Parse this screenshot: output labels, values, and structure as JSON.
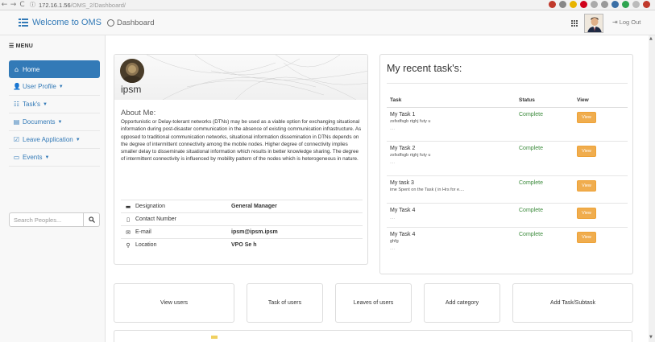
{
  "browser": {
    "back": "←",
    "forward": "→",
    "reload": "C",
    "host": "172.16.1.56",
    "path": "/OMS_2/Dashboard/"
  },
  "navbar": {
    "brand": "Welcome to OMS",
    "dashboard": "Dashboard",
    "logout": "Log Out"
  },
  "sidebar": {
    "menu_title": "MENU",
    "items": [
      {
        "label": "Home",
        "icon": "home-icon",
        "glyph": "⌂",
        "dropdown": false
      },
      {
        "label": "User Profile",
        "icon": "user-icon",
        "glyph": "👤",
        "dropdown": true
      },
      {
        "label": "Task's",
        "icon": "tasks-icon",
        "glyph": "☷",
        "dropdown": true
      },
      {
        "label": "Documents",
        "icon": "document-icon",
        "glyph": "▤",
        "dropdown": true
      },
      {
        "label": "Leave Application",
        "icon": "checkbox-icon",
        "glyph": "☑",
        "dropdown": true
      },
      {
        "label": "Events",
        "icon": "monitor-icon",
        "glyph": "▭",
        "dropdown": true
      }
    ],
    "search_placeholder": "Search Peoples..."
  },
  "profile": {
    "name": "ipsm",
    "about_title": "About Me:",
    "about_text": "Opportunistic or Delay-tolerant networks (DTNs) may be used as a viable option for exchanging situational information during post-disaster communication in the absence of existing communication infrastructure. As opposed to traditional communication networks, situational information dissemination in DTNs depends on the degree of intermittent connectivity among the mobile nodes. Higher degree of connectivity implies smaller delay to disseminate situational information which results in better knowledge sharing. The degree of intermittent connectivity is influenced by mobility pattern of the nodes which is heterogeneous in nature.",
    "details": [
      {
        "icon": "briefcase-icon",
        "glyph": "▬",
        "label": "Designation",
        "value": "General Manager"
      },
      {
        "icon": "phone-icon",
        "glyph": "▯",
        "label": "Contact Number",
        "value": ""
      },
      {
        "icon": "envelope-icon",
        "glyph": "✉",
        "label": "E-mail",
        "value": "ipsm@ipsm.ipsm"
      },
      {
        "icon": "map-marker-icon",
        "glyph": "⚲",
        "label": "Location",
        "value": "VPO Se    h"
      }
    ]
  },
  "tasks": {
    "title": "My recent task's:",
    "headers": {
      "task": "Task",
      "status": "Status",
      "view": "View"
    },
    "rows": [
      {
        "name": "My Task 1",
        "desc": "zsfsdfsgb rtghj futy u",
        "dots": "....",
        "status": "Complete",
        "view": "View"
      },
      {
        "name": "My Task 2",
        "desc": "zsfsdfsgb rtghj futy u",
        "dots": "....",
        "status": "Complete",
        "view": "View"
      },
      {
        "name": "My task 3",
        "desc": "ime Spent on the Task ( in Hrs for e....",
        "dots": "",
        "status": "Complete",
        "view": "View"
      },
      {
        "name": "My Task 4",
        "desc": "",
        "dots": "....",
        "status": "Complete",
        "view": "View"
      },
      {
        "name": "My Task 4",
        "desc": "ghfg",
        "dots": "....",
        "status": "Complete",
        "view": "View"
      }
    ]
  },
  "quick_actions": [
    "View users",
    "Task of users",
    "Leaves of users",
    "Add category",
    "Add Task/Subtask"
  ],
  "colors": {
    "primary": "#337ab7",
    "warning": "#f0ad4e",
    "success": "#3c8b3c"
  }
}
